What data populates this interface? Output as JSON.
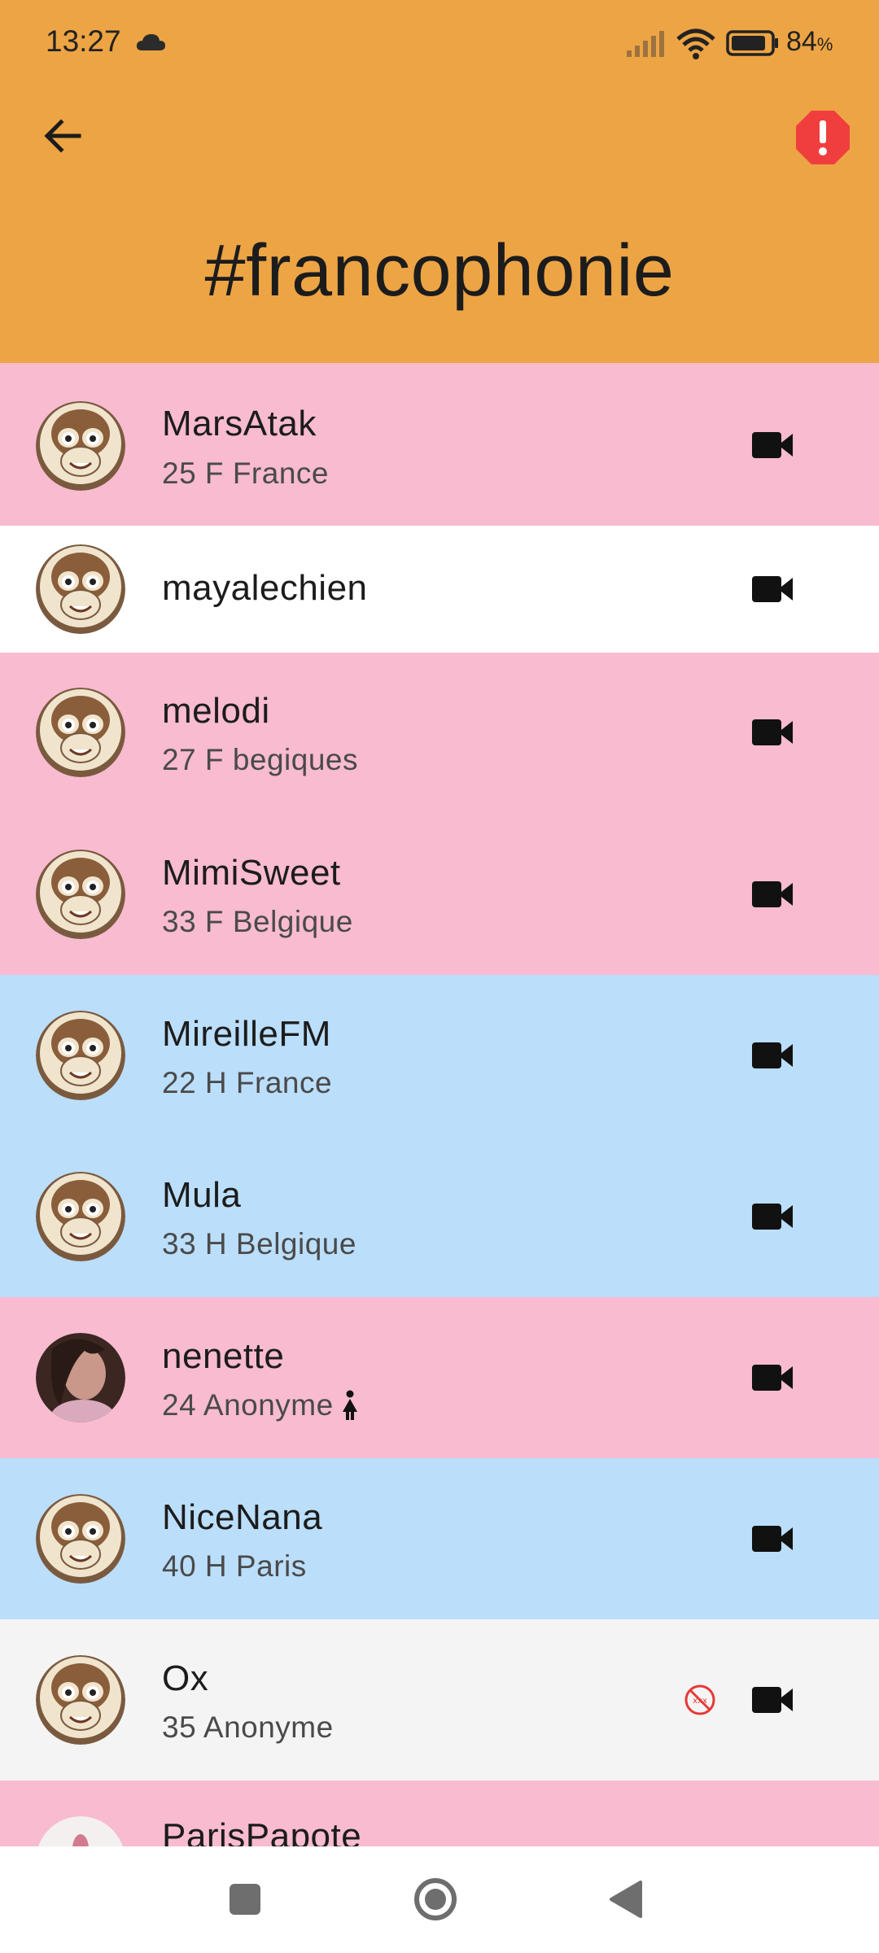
{
  "status_bar": {
    "time": "13:27",
    "battery_percent": "84",
    "battery_unit": "%",
    "icons": [
      "cloud-icon",
      "signal-icon",
      "wifi-icon",
      "battery-icon"
    ]
  },
  "header": {
    "title": "#francophonie",
    "background": "#EDA444",
    "back_icon": "arrow-left-icon",
    "alert_icon": "report-alert-icon",
    "alert_color": "#F03E3E"
  },
  "colors": {
    "female": "#F8BBD0",
    "male": "#BBDEFB",
    "neutral": "#FFFFFF",
    "anonymous": "#F4F4F5"
  },
  "users": [
    {
      "name": "MarsAtak",
      "details": "25 F France",
      "bg": "pink",
      "avatar": "monkey"
    },
    {
      "name": "mayalechien",
      "details": "",
      "bg": "white",
      "avatar": "monkey"
    },
    {
      "name": "melodi",
      "details": "27 F begiques",
      "bg": "pink",
      "avatar": "monkey"
    },
    {
      "name": "MimiSweet",
      "details": "33 F Belgique",
      "bg": "pink",
      "avatar": "monkey"
    },
    {
      "name": "MireilleFM",
      "details": "22 H France",
      "bg": "blue",
      "avatar": "monkey"
    },
    {
      "name": "Mula",
      "details": "33 H Belgique",
      "bg": "blue",
      "avatar": "monkey"
    },
    {
      "name": "nenette",
      "details": "24 Anonyme",
      "bg": "pink",
      "avatar": "photo",
      "extra_icon": "person-female-icon"
    },
    {
      "name": "NiceNana",
      "details": "40 H Paris",
      "bg": "blue",
      "avatar": "monkey"
    },
    {
      "name": "Ox",
      "details": "35 Anonyme",
      "bg": "gray",
      "avatar": "monkey",
      "badge_icon": "no-xxx-icon"
    },
    {
      "name": "ParisPapote",
      "details": "",
      "bg": "pink",
      "avatar": "photo2"
    }
  ],
  "row_action_icon": "video-camera-icon",
  "nav": {
    "items": [
      "recents-square-icon",
      "home-circle-icon",
      "back-triangle-icon"
    ]
  }
}
